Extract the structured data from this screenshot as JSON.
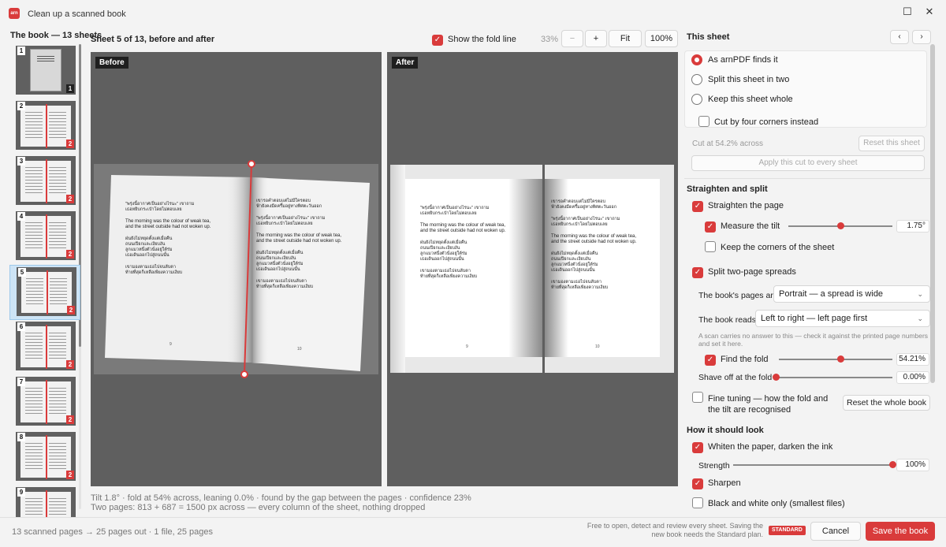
{
  "window": {
    "title": "Clean up a scanned book",
    "app_icon_text": "arn"
  },
  "sidebar": {
    "title": "The book — 13 sheets",
    "thumbs": [
      {
        "num": "1",
        "count": "1"
      },
      {
        "num": "2",
        "count": "2"
      },
      {
        "num": "3",
        "count": "2"
      },
      {
        "num": "4",
        "count": "2"
      },
      {
        "num": "5",
        "count": "2"
      },
      {
        "num": "6",
        "count": "2"
      },
      {
        "num": "7",
        "count": "2"
      },
      {
        "num": "8",
        "count": "2"
      },
      {
        "num": "9",
        "count": ""
      }
    ],
    "selected_index": 4
  },
  "toolbar": {
    "sheet_heading": "Sheet 5 of 13, before and after",
    "show_fold_label": "Show the fold line",
    "zoom_pct": "33%",
    "zoom_out": "−",
    "zoom_in": "+",
    "fit": "Fit",
    "zoom_100": "100%"
  },
  "preview": {
    "before_tag": "Before",
    "after_tag": "After",
    "page_text": {
      "thai_a": "\"พรุ่งนี้อากาศเป็นอย่างไรนะ\" เขาถาม",
      "thai_b": "เธอหยิบกระเป๋าโดยไม่ตอบเลย",
      "en_a": "The morning was the colour of weak tea,",
      "en_b": "and the street outside had not woken up.",
      "thai_c": "ฝนยังไม่หยุดตั้งแต่เมื่อคืน",
      "thai_d": "ถนนเปียกและเงียบงัน",
      "thai_e": "ลูกแมวหนึ่งตัวนั่งอยู่ใต้ร่ม",
      "thai_f": "เธอเดินออกไปสู่ถนนนั้น",
      "thai_g": "เขามองตามเธอไปจนลับตา",
      "thai_h": "ท้ายที่สุดก็เหลือเพียงความเงียบ",
      "rt_a": "เขารอคำตอบแต่ไม่มีใครตอบ",
      "rt_b": "ฟ้ายังคงมืดครึ้มอยู่ทางทิศตะวันออก",
      "num_left": "9",
      "num_right": "10"
    }
  },
  "status": {
    "line1": "Tilt 1.8° · fold at 54% across, leaning 0.0% · found by the gap between the pages · confidence 23%",
    "line2": "Two pages: 813 + 687 = 1500 px across — every column of the sheet, nothing dropped"
  },
  "panel": {
    "this_sheet": "This sheet",
    "radio_finds": "As arnPDF finds it",
    "radio_split": "Split this sheet in two",
    "radio_keep": "Keep this sheet whole",
    "cut_corners": "Cut by four corners instead",
    "cut_at": "Cut at 54.2% across",
    "reset_sheet": "Reset this sheet",
    "apply_every": "Apply this cut to every sheet",
    "straighten_split": "Straighten and split",
    "straighten_page": "Straighten the page",
    "measure_tilt": "Measure the tilt",
    "tilt_value": "1.75°",
    "tilt_level": 0.5,
    "keep_corners": "Keep the corners of the sheet",
    "split_spreads": "Split two-page spreads",
    "pages_are_label": "The book's pages are",
    "pages_are_value": "Portrait — a spread is wide",
    "reads_label": "The book reads",
    "reads_value": "Left to right — left page first",
    "hint": "A scan carries no answer to this — check it against the printed page numbers and set it here.",
    "find_fold": "Find the fold",
    "fold_value": "54.21%",
    "fold_level": 0.54,
    "shave_label": "Shave off at the fold",
    "shave_value": "0.00%",
    "shave_level": 0.0,
    "fine_tuning": "Fine tuning — how the fold and the tilt are recognised",
    "reset_book": "Reset the whole book",
    "how_look": "How it should look",
    "whiten": "Whiten the paper, darken the ink",
    "strength_label": "Strength",
    "strength_value": "100%",
    "strength_level": 1.0,
    "sharpen": "Sharpen",
    "bw_only": "Black and white only (smallest files)"
  },
  "footer": {
    "summary": "13 scanned pages → 25 pages out · 1 file, 25 pages",
    "note": "Free to open, detect and review every sheet. Saving the new book needs the Standard plan.",
    "badge": "STANDARD",
    "cancel": "Cancel",
    "save": "Save the book"
  },
  "colors": {
    "accent": "#d93b3b"
  }
}
